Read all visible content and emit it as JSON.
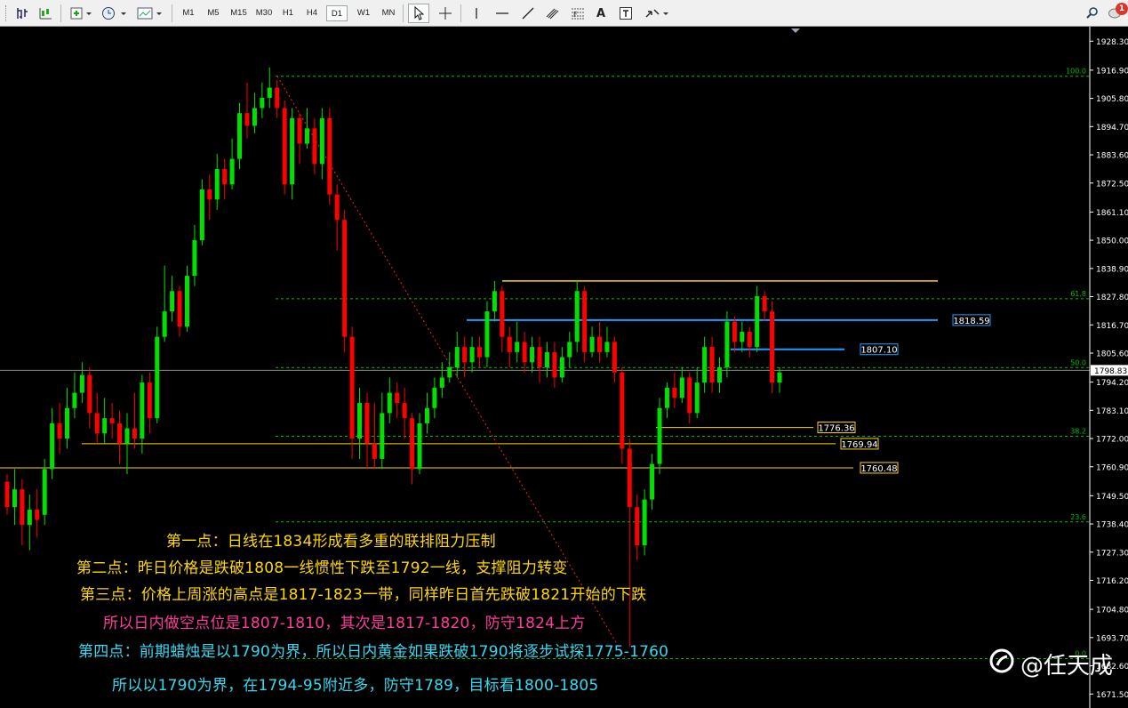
{
  "toolbar": {
    "timeframes": [
      "M1",
      "M5",
      "M15",
      "M30",
      "H1",
      "H4",
      "D1",
      "W1",
      "MN"
    ],
    "active_timeframe": "D1",
    "text_tool": "A",
    "notification_count": "1"
  },
  "colors": {
    "bull": "#00e000",
    "bear": "#ff0000",
    "fib": "#00c000",
    "resistance": "#ffd700",
    "blue_line": "#1e9cff",
    "trend": "#ff2020",
    "axis_text": "#ffffff"
  },
  "chart_data": {
    "type": "candlestick",
    "symbol_timeframe": "D1",
    "ylim": [
      1666.0,
      1934.0
    ],
    "y_ticks": [
      "1928.30",
      "1916.90",
      "1905.80",
      "1894.70",
      "1883.60",
      "1872.50",
      "1861.10",
      "1850.00",
      "1838.90",
      "1827.80",
      "1816.70",
      "1805.60",
      "1794.20",
      "1783.10",
      "1772.00",
      "1760.90",
      "1749.50",
      "1738.40",
      "1727.30",
      "1716.20",
      "1704.80",
      "1693.70",
      "1682.60",
      "1671.50"
    ],
    "current_price": "1798.83",
    "fib_levels": [
      {
        "label": "100.0",
        "value": 1914.5
      },
      {
        "label": "61.8",
        "value": 1827.0
      },
      {
        "label": "50.0",
        "value": 1799.9
      },
      {
        "label": "38.2",
        "value": 1772.9
      },
      {
        "label": "23.6",
        "value": 1739.2
      },
      {
        "label": "0.0",
        "value": 1685.4
      }
    ],
    "price_labels": [
      {
        "label": "1818.59",
        "value": 1818.59,
        "color": "#1e9cff"
      },
      {
        "label": "1807.10",
        "value": 1807.1,
        "color": "#1e9cff"
      },
      {
        "label": "1776.36",
        "value": 1776.36,
        "color": "#ffd700"
      },
      {
        "label": "1769.94",
        "value": 1769.94,
        "color": "#ffd700"
      },
      {
        "label": "1760.48",
        "value": 1760.48,
        "color": "#ffd700"
      }
    ],
    "resistance_level": 1834.0,
    "candles": [
      [
        1755,
        1745,
        1758,
        1742
      ],
      [
        1745,
        1752,
        1760,
        1738
      ],
      [
        1752,
        1738,
        1756,
        1730
      ],
      [
        1738,
        1744,
        1750,
        1728
      ],
      [
        1744,
        1740,
        1752,
        1733
      ],
      [
        1742,
        1760,
        1764,
        1738
      ],
      [
        1760,
        1778,
        1784,
        1756
      ],
      [
        1778,
        1772,
        1786,
        1766
      ],
      [
        1772,
        1784,
        1792,
        1768
      ],
      [
        1784,
        1790,
        1798,
        1780
      ],
      [
        1790,
        1797,
        1802,
        1786
      ],
      [
        1797,
        1782,
        1800,
        1776
      ],
      [
        1782,
        1774,
        1790,
        1770
      ],
      [
        1774,
        1780,
        1788,
        1770
      ],
      [
        1780,
        1778,
        1786,
        1772
      ],
      [
        1778,
        1770,
        1783,
        1762
      ],
      [
        1770,
        1776,
        1782,
        1758
      ],
      [
        1776,
        1772,
        1790,
        1768
      ],
      [
        1772,
        1794,
        1797,
        1766
      ],
      [
        1794,
        1780,
        1798,
        1774
      ],
      [
        1780,
        1812,
        1816,
        1778
      ],
      [
        1812,
        1822,
        1840,
        1810
      ],
      [
        1822,
        1830,
        1836,
        1818
      ],
      [
        1830,
        1816,
        1832,
        1812
      ],
      [
        1816,
        1836,
        1840,
        1814
      ],
      [
        1836,
        1850,
        1856,
        1832
      ],
      [
        1850,
        1870,
        1874,
        1848
      ],
      [
        1870,
        1866,
        1876,
        1858
      ],
      [
        1866,
        1878,
        1884,
        1862
      ],
      [
        1878,
        1872,
        1882,
        1866
      ],
      [
        1872,
        1882,
        1890,
        1870
      ],
      [
        1882,
        1900,
        1904,
        1878
      ],
      [
        1900,
        1895,
        1912,
        1890
      ],
      [
        1895,
        1902,
        1908,
        1892
      ],
      [
        1902,
        1906,
        1912,
        1898
      ],
      [
        1906,
        1910,
        1918,
        1902
      ],
      [
        1910,
        1902,
        1913,
        1898
      ],
      [
        1902,
        1872,
        1905,
        1868
      ],
      [
        1872,
        1898,
        1902,
        1866
      ],
      [
        1898,
        1888,
        1900,
        1880
      ],
      [
        1888,
        1894,
        1902,
        1886
      ],
      [
        1894,
        1880,
        1898,
        1876
      ],
      [
        1880,
        1898,
        1902,
        1874
      ],
      [
        1898,
        1868,
        1902,
        1864
      ],
      [
        1868,
        1858,
        1872,
        1846
      ],
      [
        1858,
        1812,
        1862,
        1806
      ],
      [
        1812,
        1772,
        1816,
        1764
      ],
      [
        1772,
        1786,
        1792,
        1764
      ],
      [
        1786,
        1770,
        1790,
        1760
      ],
      [
        1770,
        1764,
        1786,
        1760
      ],
      [
        1764,
        1782,
        1790,
        1760
      ],
      [
        1782,
        1790,
        1796,
        1778
      ],
      [
        1790,
        1786,
        1794,
        1780
      ],
      [
        1786,
        1780,
        1792,
        1772
      ],
      [
        1780,
        1760,
        1782,
        1754
      ],
      [
        1760,
        1778,
        1782,
        1758
      ],
      [
        1778,
        1784,
        1790,
        1774
      ],
      [
        1784,
        1792,
        1796,
        1780
      ],
      [
        1792,
        1796,
        1802,
        1788
      ],
      [
        1796,
        1800,
        1806,
        1794
      ],
      [
        1800,
        1808,
        1814,
        1796
      ],
      [
        1808,
        1802,
        1812,
        1796
      ],
      [
        1802,
        1808,
        1812,
        1798
      ],
      [
        1808,
        1804,
        1812,
        1800
      ],
      [
        1804,
        1822,
        1826,
        1800
      ],
      [
        1822,
        1830,
        1834,
        1818
      ],
      [
        1830,
        1812,
        1832,
        1806
      ],
      [
        1812,
        1806,
        1816,
        1800
      ],
      [
        1806,
        1810,
        1818,
        1802
      ],
      [
        1810,
        1802,
        1814,
        1798
      ],
      [
        1802,
        1808,
        1812,
        1798
      ],
      [
        1808,
        1800,
        1812,
        1794
      ],
      [
        1800,
        1806,
        1810,
        1796
      ],
      [
        1806,
        1796,
        1810,
        1792
      ],
      [
        1796,
        1804,
        1808,
        1794
      ],
      [
        1804,
        1810,
        1814,
        1800
      ],
      [
        1810,
        1830,
        1834,
        1806
      ],
      [
        1830,
        1806,
        1832,
        1802
      ],
      [
        1806,
        1812,
        1816,
        1804
      ],
      [
        1812,
        1806,
        1818,
        1802
      ],
      [
        1806,
        1810,
        1816,
        1804
      ],
      [
        1810,
        1798,
        1812,
        1794
      ],
      [
        1798,
        1768,
        1800,
        1762
      ],
      [
        1768,
        1745,
        1772,
        1690
      ],
      [
        1745,
        1730,
        1750,
        1724
      ],
      [
        1730,
        1748,
        1752,
        1726
      ],
      [
        1748,
        1762,
        1766,
        1744
      ],
      [
        1762,
        1784,
        1788,
        1758
      ],
      [
        1784,
        1792,
        1794,
        1780
      ],
      [
        1792,
        1788,
        1798,
        1784
      ],
      [
        1788,
        1796,
        1800,
        1786
      ],
      [
        1796,
        1782,
        1798,
        1778
      ],
      [
        1782,
        1794,
        1800,
        1780
      ],
      [
        1794,
        1808,
        1812,
        1790
      ],
      [
        1808,
        1794,
        1812,
        1790
      ],
      [
        1794,
        1800,
        1804,
        1790
      ],
      [
        1800,
        1818,
        1822,
        1796
      ],
      [
        1818,
        1810,
        1820,
        1806
      ],
      [
        1810,
        1814,
        1818,
        1806
      ],
      [
        1814,
        1808,
        1816,
        1804
      ],
      [
        1808,
        1828,
        1832,
        1806
      ],
      [
        1828,
        1822,
        1830,
        1818
      ],
      [
        1822,
        1794,
        1826,
        1790
      ],
      [
        1794,
        1798,
        1800,
        1790
      ]
    ]
  },
  "notes": [
    {
      "text": "第一点：日线在1834形成看多重的联排阻力压制",
      "color": "#ffd700"
    },
    {
      "text": "第二点：昨日价格是跌破1808一线惯性下跌至1792一线，支撑阻力转变",
      "color": "#ffd700"
    },
    {
      "text": "第三点：价格上周涨的高点是1817-1823一带，同样昨日首先跌破1821开始的下跌",
      "color": "#ffd700"
    },
    {
      "text": "所以日内做空点位是1807-1810，其次是1817-1820，防守1824上方",
      "color": "#ff3c9c"
    },
    {
      "text": "第四点：前期蜡烛是以1790为界，所以日内黄金如果跌破1790将逐步试探1775-1760",
      "color": "#38d8f0"
    },
    {
      "text": "所以以1790为界，在1794-95附近多，防守1789，目标看1800-1805",
      "color": "#38d8f0"
    }
  ],
  "watermark": {
    "text": "@任天成"
  }
}
